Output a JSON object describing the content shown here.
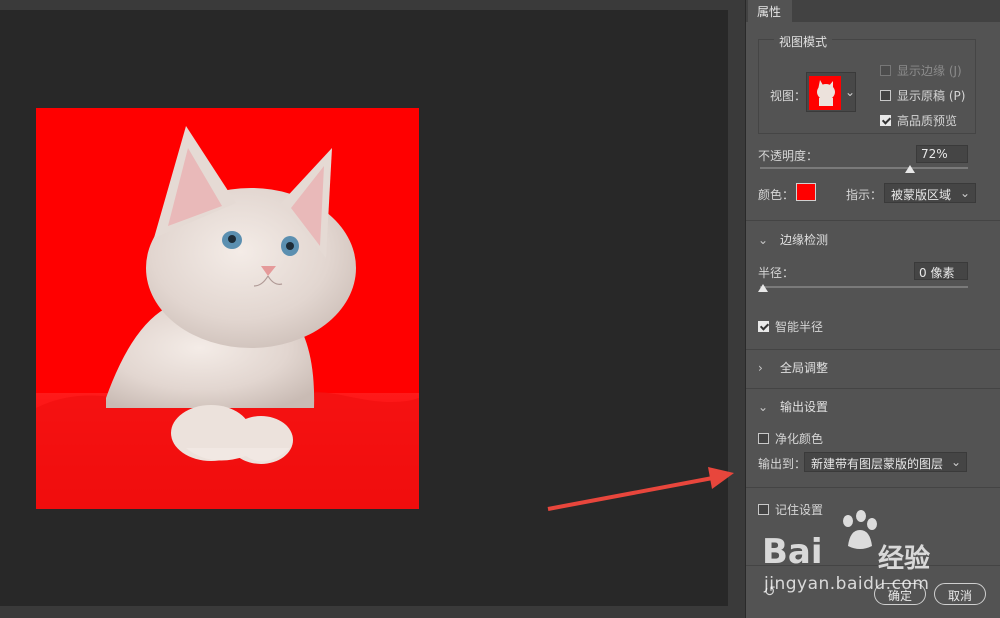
{
  "panel": {
    "tab_label": "属性",
    "view_mode": {
      "group_label": "视图模式",
      "view_label": "视图：",
      "show_edge_label": "显示边缘 (J)",
      "show_edge_checked": false,
      "show_edge_enabled": false,
      "show_original_label": "显示原稿 (P)",
      "show_original_checked": false,
      "hq_preview_label": "高品质预览",
      "hq_preview_checked": true
    },
    "opacity": {
      "label": "不透明度：",
      "value": "72%",
      "fraction": 0.72
    },
    "color": {
      "label": "颜色：",
      "swatch": "#ff0000"
    },
    "indicates": {
      "label": "指示：",
      "value": "被蒙版区域"
    },
    "edge_detection": {
      "title": "边缘检测",
      "expanded": true,
      "radius_label": "半径：",
      "radius_value": "0 像素",
      "radius_fraction": 0,
      "smart_radius_label": "智能半径",
      "smart_radius_checked": true
    },
    "global_refine": {
      "title": "全局调整",
      "expanded": false
    },
    "output": {
      "title": "输出设置",
      "expanded": true,
      "decontaminate_label": "净化颜色",
      "decontaminate_checked": false,
      "output_to_label": "输出到：",
      "output_to_value": "新建带有图层蒙版的图层"
    },
    "remember_label": "记住设置",
    "remember_checked": false,
    "ok_label": "确定",
    "cancel_label": "取消"
  },
  "watermark": {
    "brand": "Bai",
    "brand_tail": "经验",
    "url": "jingyan.baidu.com"
  },
  "colors": {
    "overlay": "#ff0000",
    "arrow": "#e8463c"
  }
}
